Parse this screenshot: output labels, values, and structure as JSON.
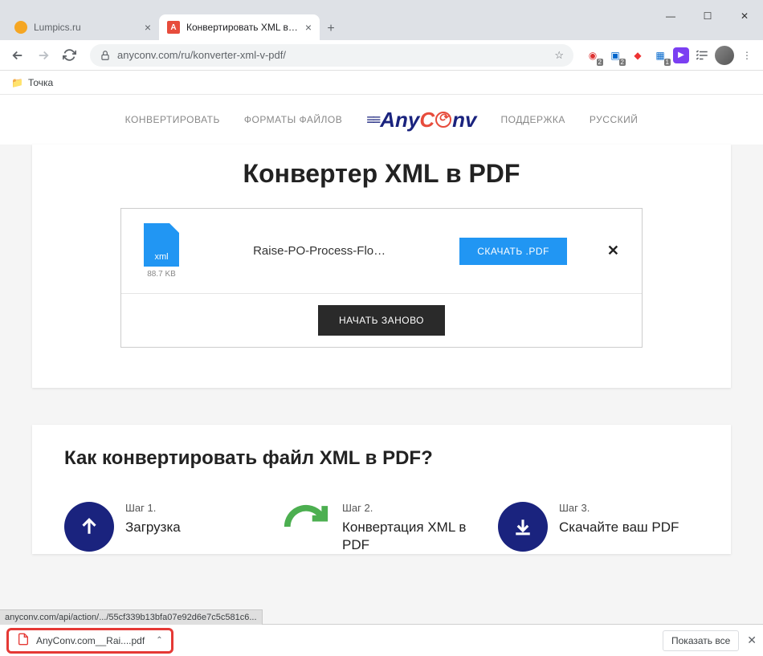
{
  "window": {
    "tabs": [
      {
        "title": "Lumpics.ru"
      },
      {
        "title": "Конвертировать XML в PDF онл"
      }
    ]
  },
  "toolbar": {
    "url": "anyconv.com/ru/konverter-xml-v-pdf/",
    "ext_badges": {
      "a": "2",
      "b": "2",
      "c": "1"
    }
  },
  "bookmarks": {
    "item1": "Точка"
  },
  "nav": {
    "convert": "КОНВЕРТИРОВАТЬ",
    "formats": "ФОРМАТЫ ФАЙЛОВ",
    "support": "ПОДДЕРЖКА",
    "lang": "РУССКИЙ"
  },
  "logo": {
    "any": "Any",
    "c": "C",
    "nv": "nv"
  },
  "page": {
    "h1": "Конвертер XML в PDF",
    "file": {
      "ext": "xml",
      "size": "88.7 KB",
      "name": "Raise-PO-Process-Flo…"
    },
    "download_btn": "СКАЧАТЬ .PDF",
    "restart_btn": "НАЧАТЬ ЗАНОВО",
    "howto_title": "Как конвертировать файл XML в PDF?",
    "steps": [
      {
        "num": "Шаг 1.",
        "title": "Загрузка"
      },
      {
        "num": "Шаг 2.",
        "title": "Конвертация XML в PDF"
      },
      {
        "num": "Шаг 3.",
        "title": "Скачайте ваш PDF"
      }
    ]
  },
  "status_url": "anyconv.com/api/action/.../55cf339b13bfa07e92d6e7c5c581c6...",
  "shelf": {
    "item": "AnyConv.com__Rai....pdf",
    "show_all": "Показать все"
  }
}
